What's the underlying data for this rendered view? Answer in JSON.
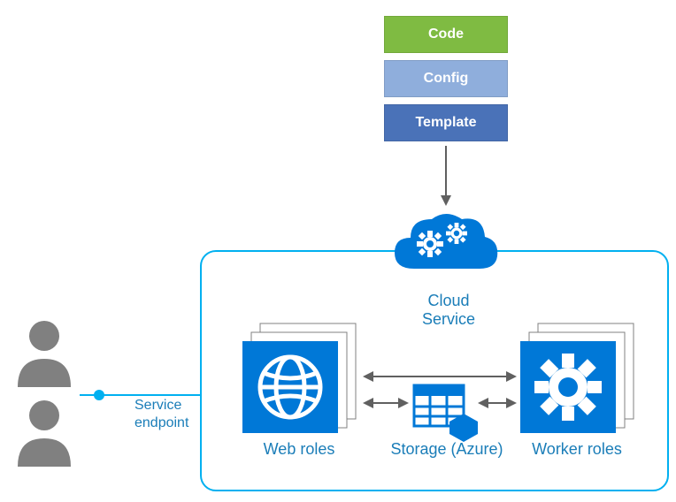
{
  "stack": {
    "code": "Code",
    "config": "Config",
    "template": "Template"
  },
  "labels": {
    "cloud_service": "Cloud Service",
    "service_endpoint_l1": "Service",
    "service_endpoint_l2": "endpoint",
    "web_roles": "Web roles",
    "worker_roles": "Worker roles",
    "storage": "Storage (Azure)"
  },
  "colors": {
    "azure_blue": "#0078d7",
    "border_cyan": "#00b0f0",
    "code_green": "#7fbb42",
    "config_blue": "#8faedc",
    "template_blue": "#4a72b8",
    "user_grey": "#808080"
  }
}
